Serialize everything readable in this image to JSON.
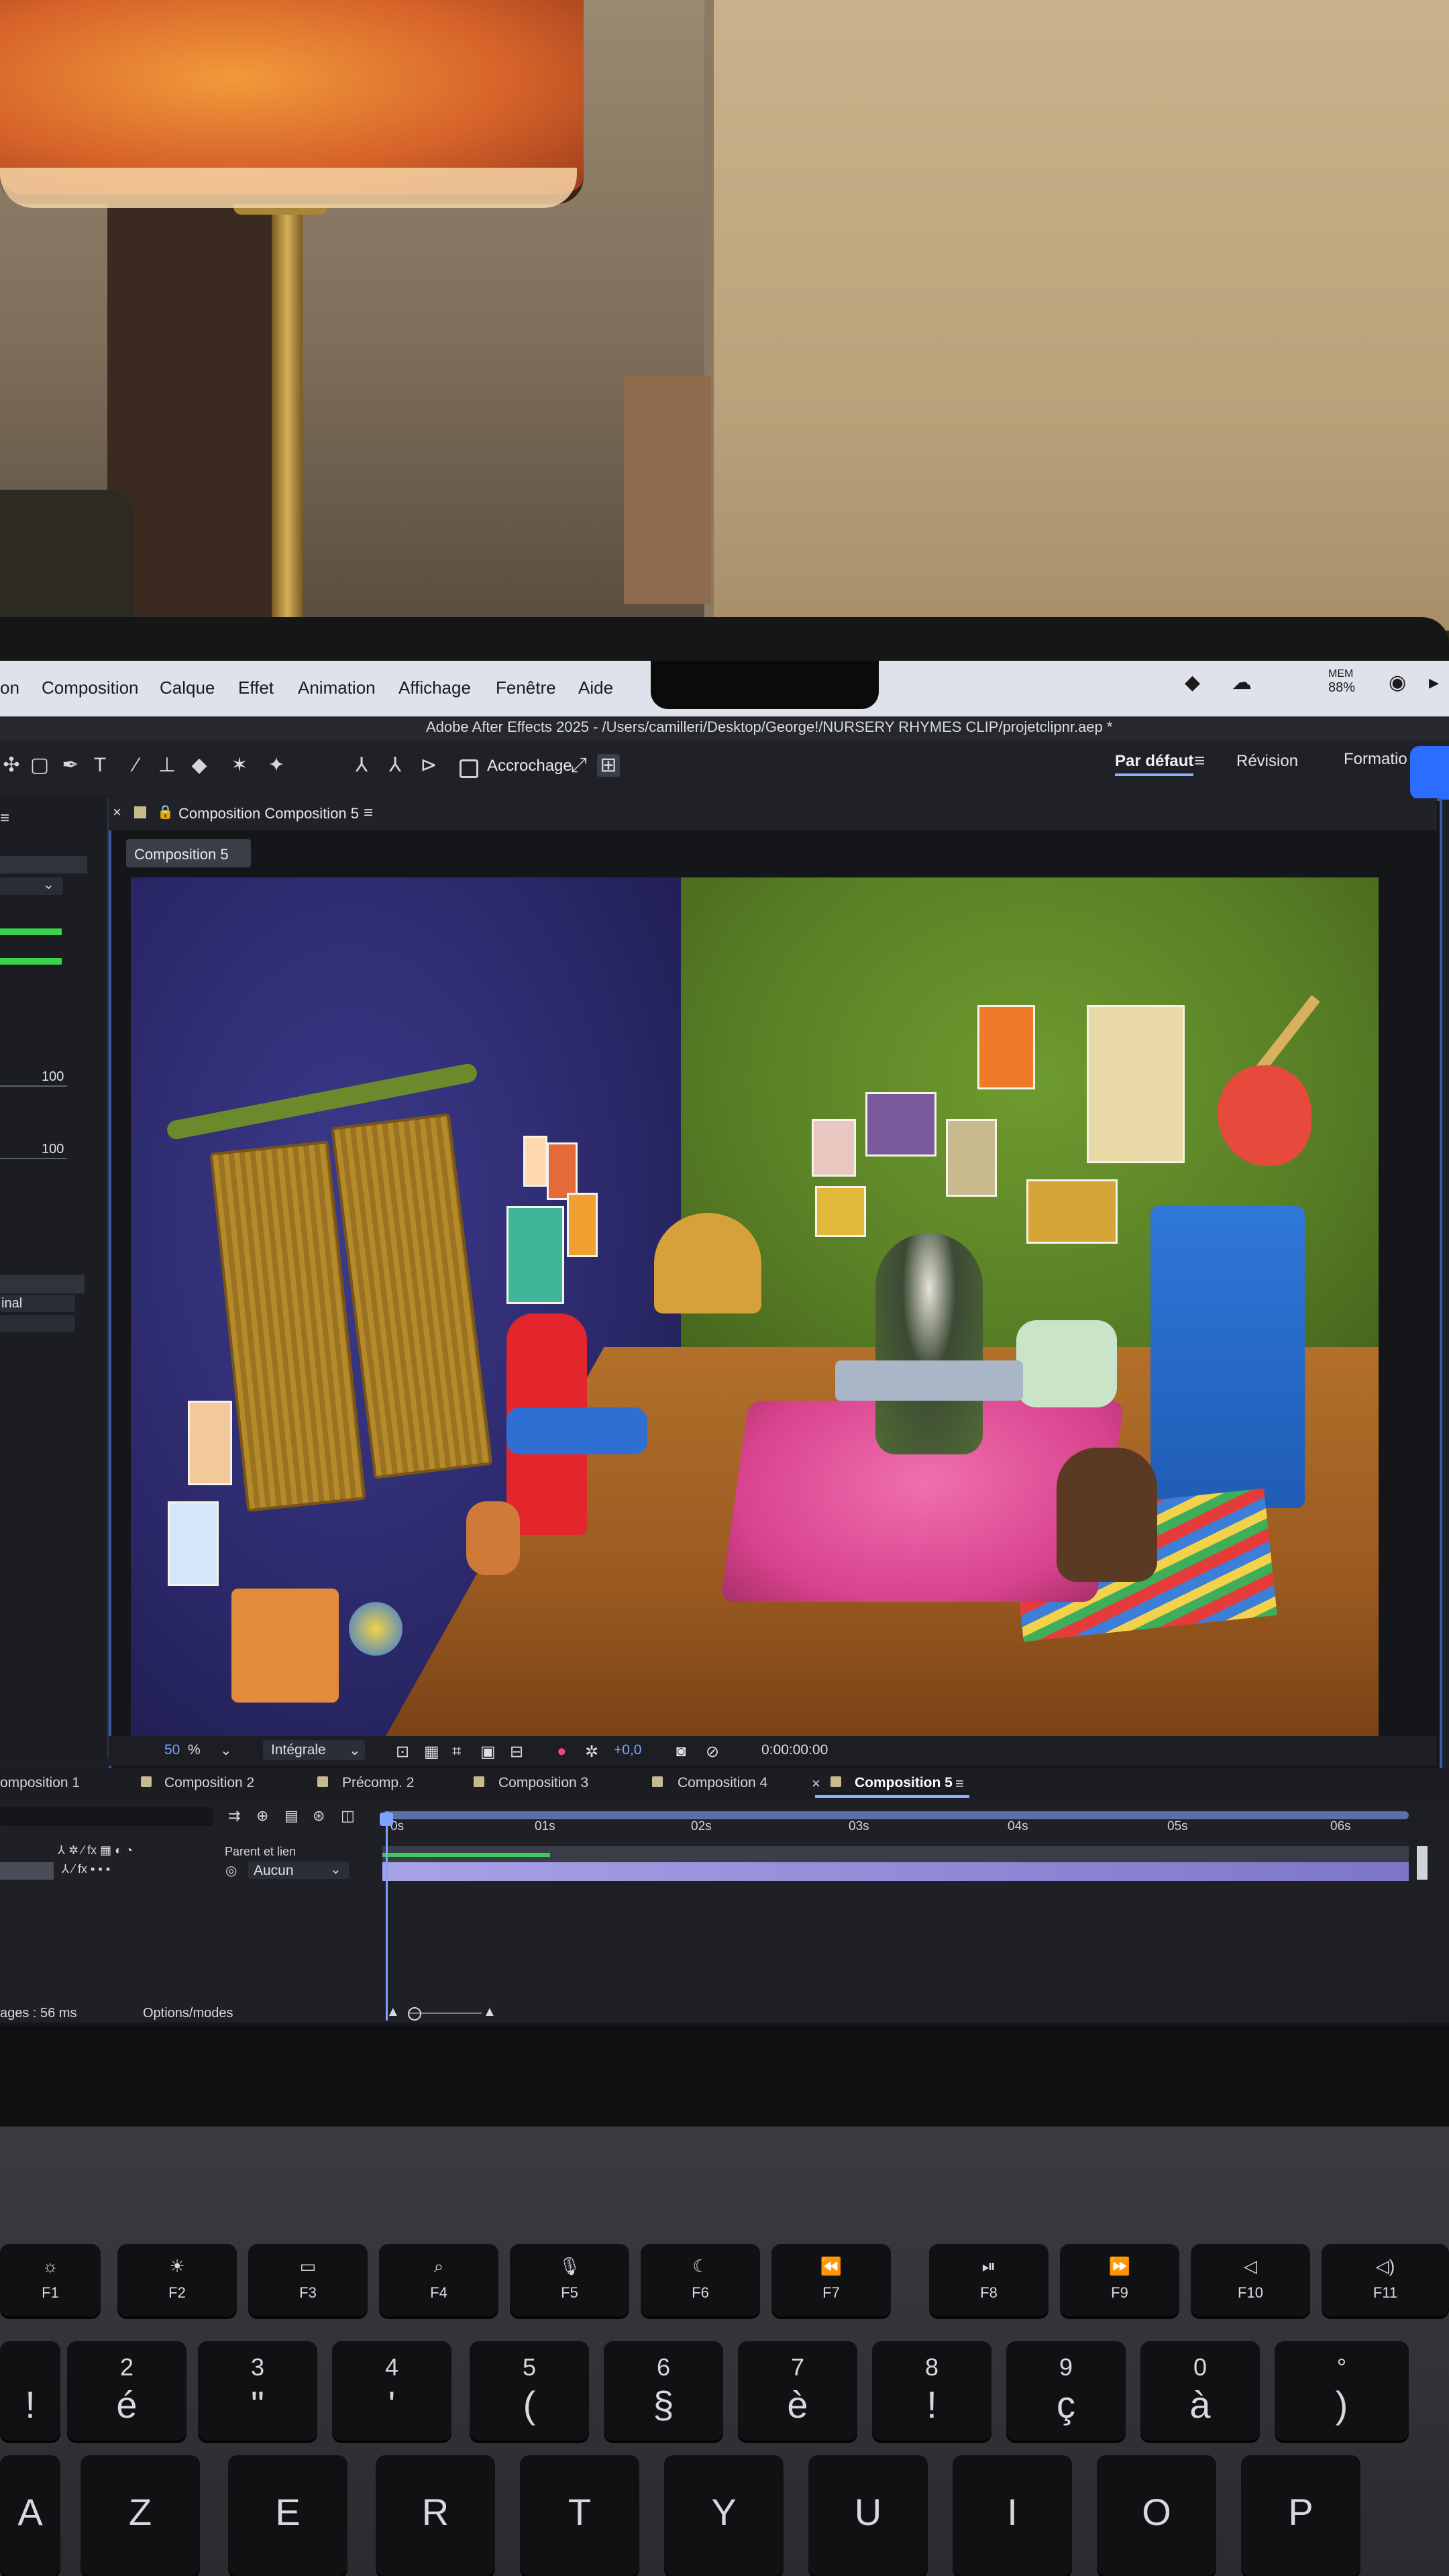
{
  "menubar": {
    "items": [
      "on",
      "Composition",
      "Calque",
      "Effet",
      "Animation",
      "Affichage",
      "Fenêtre",
      "Aide"
    ],
    "mem_label": "MEM",
    "mem_value": "88%"
  },
  "app": {
    "title": "Adobe After Effects 2025 - /Users/camilleri/Desktop/George!/NURSERY RHYMES CLIP/projetclipnr.aep *"
  },
  "toolbar": {
    "snap_label": "Accrochage",
    "workspace_default": "Par défaut",
    "workspace_review": "Révision",
    "workspace_training": "Formatio"
  },
  "left_panel": {
    "value_1": "100",
    "value_2": "100",
    "dropdown_1": "inal",
    "dropdown_2": ""
  },
  "composition_panel": {
    "title": "Composition Composition 5",
    "breadcrumb": "Composition 5"
  },
  "viewer_bar": {
    "zoom": "50",
    "zoom_unit": "%",
    "resolution": "Intégrale",
    "exposure": "+0,0",
    "timecode": "0:00:00:00"
  },
  "tabs": [
    {
      "label": "omposition 1"
    },
    {
      "label": "Composition 2"
    },
    {
      "label": "Précomp. 2"
    },
    {
      "label": "Composition 3"
    },
    {
      "label": "Composition 4"
    },
    {
      "label": "Composition 5"
    }
  ],
  "timeline": {
    "ruler_labels": [
      "0s",
      "01s",
      "02s",
      "03s",
      "04s",
      "05s",
      "06s"
    ],
    "parent_header": "Parent et lien",
    "parent_value": "Aucun",
    "render_time": "ages : 56 ms",
    "options_label": "Options/modes"
  },
  "keyboard": {
    "fkeys": [
      {
        "glyph": "☼",
        "label": "F1"
      },
      {
        "glyph": "☀",
        "label": "F2"
      },
      {
        "glyph": "▭",
        "label": "F3"
      },
      {
        "glyph": "⌕",
        "label": "F4"
      },
      {
        "glyph": "🎙",
        "label": "F5"
      },
      {
        "glyph": "☾",
        "label": "F6"
      },
      {
        "glyph": "⏪",
        "label": "F7"
      },
      {
        "glyph": "⏯",
        "label": "F8"
      },
      {
        "glyph": "⏩",
        "label": "F9"
      },
      {
        "glyph": "◁",
        "label": "F10"
      },
      {
        "glyph": "◁)",
        "label": "F11"
      }
    ],
    "number_row": [
      {
        "top": "",
        "main": "!"
      },
      {
        "top": "2",
        "main": "é"
      },
      {
        "top": "3",
        "main": "\""
      },
      {
        "top": "4",
        "main": "'"
      },
      {
        "top": "5",
        "main": "("
      },
      {
        "top": "6",
        "main": "§"
      },
      {
        "top": "7",
        "main": "è"
      },
      {
        "top": "8",
        "main": "!"
      },
      {
        "top": "9",
        "main": "ç"
      },
      {
        "top": "0",
        "main": "à"
      },
      {
        "top": "°",
        "main": ")"
      }
    ],
    "letter_row": [
      "A",
      "Z",
      "E",
      "R",
      "T",
      "Y",
      "U",
      "I",
      "O",
      "P"
    ]
  },
  "colors": {
    "accent": "#8fb0ff",
    "selection_border": "#3a57a8",
    "layer_bar": "#a7a3e6",
    "work_area_green": "#3acb62"
  }
}
